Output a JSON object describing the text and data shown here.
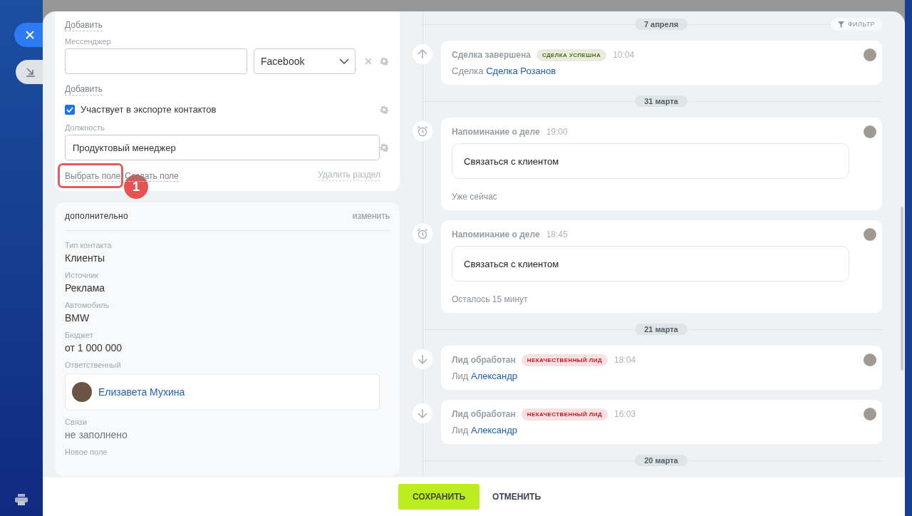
{
  "contact_form": {
    "add_link_top": "Добавить",
    "messenger": {
      "label": "Мессенджер",
      "type": "Facebook"
    },
    "add_link": "Добавить",
    "export_checkbox": {
      "label": "Участвует в экспорте контактов",
      "checked": true
    },
    "position": {
      "label": "Должность",
      "value": "Продуктовый менеджер"
    },
    "actions": [
      {
        "label": "Выбрать поле",
        "highlighted": true
      },
      {
        "label": "Создать поле",
        "highlighted": false
      }
    ],
    "delete_section": "Удалить раздел"
  },
  "callout": {
    "number": "1"
  },
  "extra_section": {
    "title": "дополнительно",
    "edit": "изменить",
    "fields": [
      {
        "kind": "text",
        "label": "Тип контакта",
        "value": "Клиенты"
      },
      {
        "kind": "text",
        "label": "Источник",
        "value": "Реклама"
      },
      {
        "kind": "text",
        "label": "Автомобиль",
        "value": "BMW"
      },
      {
        "kind": "text",
        "label": "Бюджет",
        "value": "от 1 000 000"
      },
      {
        "kind": "user",
        "label": "Ответственный",
        "value": "Елизавета Мухина"
      },
      {
        "kind": "empty",
        "label": "Связи",
        "value": "не заполнено"
      },
      {
        "kind": "label",
        "label": "Новое поле"
      }
    ]
  },
  "timeline": {
    "filter": "ФИЛЬТР",
    "groups": [
      {
        "date": "7 апреля",
        "events": [
          {
            "kind": "deal_status",
            "title": "Сделка завершена",
            "badge": {
              "text": "СДЕЛКА УСПЕШНА",
              "color": "#4f6f10"
            },
            "time": "10:04",
            "entity_label": "Сделка",
            "entity_link": "Сделка Розанов"
          }
        ]
      },
      {
        "date": "31 марта",
        "events": [
          {
            "kind": "reminder",
            "title": "Напоминание о деле",
            "time": "19:00",
            "note": "Связаться с клиентом",
            "footer": "Уже сейчас"
          },
          {
            "kind": "reminder",
            "title": "Напоминание о деле",
            "time": "18:45",
            "note": "Связаться с клиентом",
            "footer": "Осталось 15 минут"
          }
        ]
      },
      {
        "date": "21 марта",
        "events": [
          {
            "kind": "lead_status",
            "title": "Лид обработан",
            "badge": {
              "text": "НЕКАЧЕСТВЕННЫЙ ЛИД",
              "color": "#c4161c"
            },
            "time": "18:04",
            "entity_label": "Лид",
            "entity_link": "Александр"
          },
          {
            "kind": "lead_status",
            "title": "Лид обработан",
            "badge": {
              "text": "НЕКАЧЕСТВЕННЫЙ ЛИД",
              "color": "#c4161c"
            },
            "time": "16:03",
            "entity_label": "Лид",
            "entity_link": "Александр"
          }
        ]
      },
      {
        "date": "20 марта"
      }
    ]
  },
  "footer": {
    "save": "СОХРАНИТЬ",
    "cancel": "ОТМЕНИТЬ"
  }
}
